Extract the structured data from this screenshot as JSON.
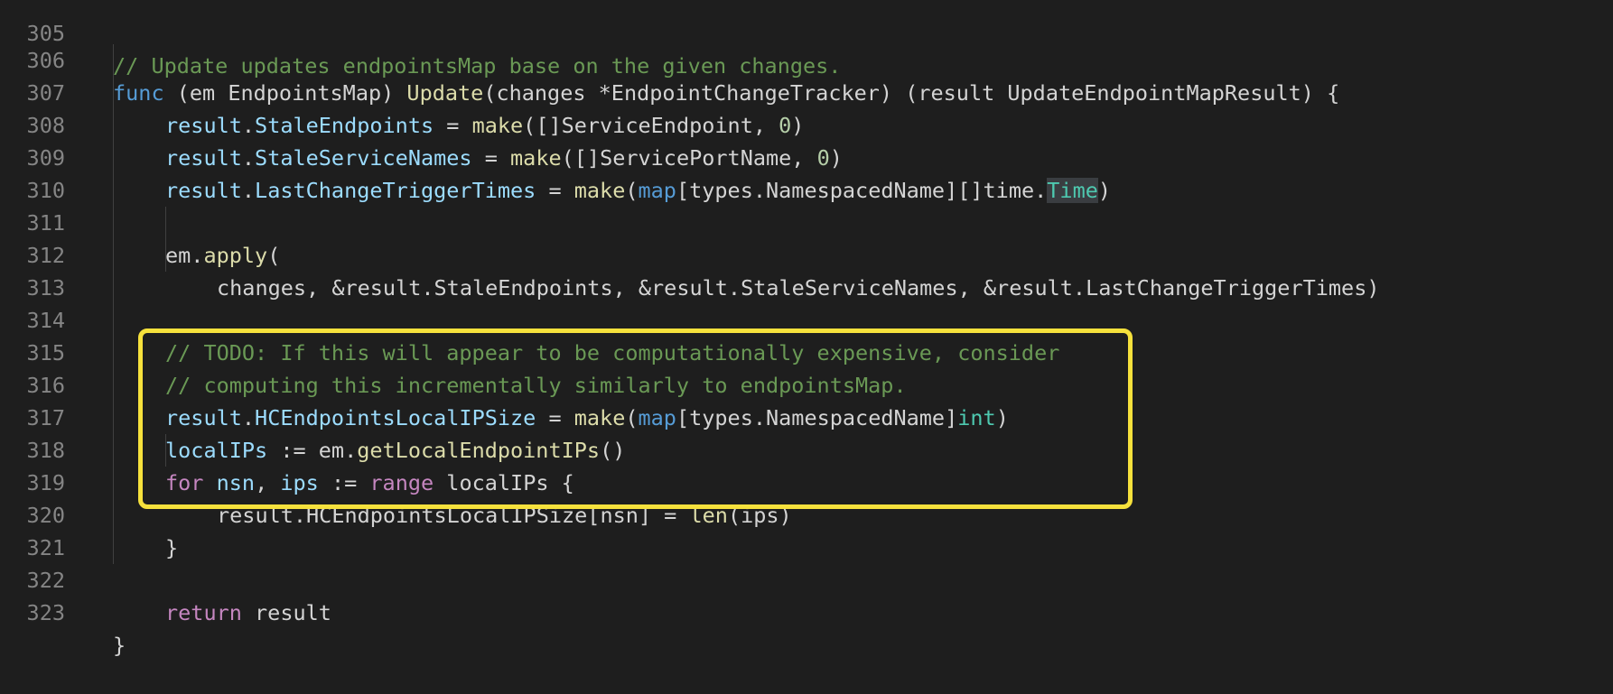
{
  "editor": {
    "colors": {
      "background": "#1e1e1e",
      "line_number": "#858585",
      "highlight_box": "#f6e13c"
    },
    "lines": [
      {
        "number": "305",
        "text": "// Update updates endpointsMap base on the given changes."
      },
      {
        "number": "306",
        "tokens": [
          "func",
          " (em EndpointsMap) ",
          "Update",
          "(changes *EndpointChangeTracker) (result UpdateEndpointMapResult) {"
        ]
      },
      {
        "number": "307",
        "tokens": [
          "result",
          ".",
          "StaleEndpoints",
          " = ",
          "make",
          "([]ServiceEndpoint, ",
          "0",
          ")"
        ]
      },
      {
        "number": "308",
        "tokens": [
          "result",
          ".",
          "StaleServiceNames",
          " = ",
          "make",
          "([]ServicePortName, ",
          "0",
          ")"
        ]
      },
      {
        "number": "309",
        "tokens": [
          "result",
          ".",
          "LastChangeTriggerTimes",
          " = ",
          "make",
          "(",
          "map",
          "[types.NamespacedName][]time.",
          "Time",
          ")"
        ]
      },
      {
        "number": "310",
        "text": ""
      },
      {
        "number": "311",
        "tokens": [
          "em.",
          "apply",
          "("
        ]
      },
      {
        "number": "312",
        "text": "changes, &result.StaleEndpoints, &result.StaleServiceNames, &result.LastChangeTriggerTimes)"
      },
      {
        "number": "313",
        "text": ""
      },
      {
        "number": "314",
        "text": "// TODO: If this will appear to be computationally expensive, consider"
      },
      {
        "number": "315",
        "text": "// computing this incrementally similarly to endpointsMap."
      },
      {
        "number": "316",
        "tokens": [
          "result",
          ".",
          "HCEndpointsLocalIPSize",
          " = ",
          "make",
          "(",
          "map",
          "[types.NamespacedName]",
          "int",
          ")"
        ]
      },
      {
        "number": "317",
        "tokens": [
          "localIPs",
          " := em.",
          "getLocalEndpointIPs",
          "()"
        ]
      },
      {
        "number": "318",
        "tokens": [
          "for",
          " ",
          "nsn",
          ", ",
          "ips",
          " := ",
          "range",
          " localIPs {"
        ]
      },
      {
        "number": "319",
        "tokens": [
          "result.HCEndpointsLocalIPSize[nsn] = ",
          "len",
          "(ips)"
        ]
      },
      {
        "number": "320",
        "text": "}"
      },
      {
        "number": "321",
        "text": ""
      },
      {
        "number": "322",
        "tokens": [
          "return",
          " result"
        ]
      },
      {
        "number": "323",
        "text": "}"
      }
    ]
  }
}
